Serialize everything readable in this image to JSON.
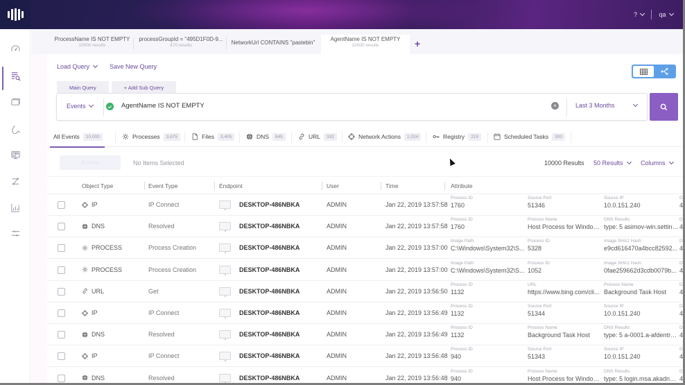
{
  "topbar": {
    "help_label": "?",
    "user_label": "qa"
  },
  "rail": {
    "items": [
      {
        "icon": "dashboard-gauge-icon",
        "active": false
      },
      {
        "icon": "event-search-icon",
        "active": true
      },
      {
        "icon": "endpoint-monitor-icon",
        "active": false
      },
      {
        "icon": "threat-hunting-icon",
        "active": false
      },
      {
        "icon": "devices-icon",
        "active": false
      },
      {
        "icon": "network-flow-icon",
        "active": false
      },
      {
        "icon": "reports-chart-icon",
        "active": false
      },
      {
        "icon": "settings-sliders-icon",
        "active": false
      }
    ]
  },
  "query_tabs": [
    {
      "title": "ProcessName IS NOT EMPTY",
      "sub": "10000 results",
      "active": false
    },
    {
      "title": "processGroupId = \"495D1F0D-9...",
      "sub": "470 results",
      "active": false
    },
    {
      "title": "NetworkUrl CONTAINS \"pastebin\"",
      "sub": "",
      "active": false
    },
    {
      "title": "AgentName IS NOT EMPTY",
      "sub": "10000 results",
      "active": true
    }
  ],
  "add_tab_label": "+",
  "toolbar": {
    "load_query": "Load Query",
    "save_new_query": "Save New Query"
  },
  "sub_tabs": {
    "main_query": "Main Query",
    "add_sub_query": "+ Add Sub Query"
  },
  "query": {
    "scope": "Events",
    "text": "AgentName IS NOT EMPTY",
    "time_range": "Last 3 Months",
    "valid_color": "#3bb36b",
    "accent_color": "#8b5ec4"
  },
  "filters": [
    {
      "label": "All Events",
      "count": "10,000",
      "icon": "",
      "active": true
    },
    {
      "label": "Processes",
      "count": "3,875",
      "icon": "gear-icon",
      "active": false
    },
    {
      "label": "Files",
      "count": "3,405",
      "icon": "file-icon",
      "active": false
    },
    {
      "label": "DNS",
      "count": "845",
      "icon": "globe-icon",
      "active": false
    },
    {
      "label": "URL",
      "count": "332",
      "icon": "link-icon",
      "active": false
    },
    {
      "label": "Network Actions",
      "count": "1,024",
      "icon": "network-icon",
      "active": false
    },
    {
      "label": "Registry",
      "count": "219",
      "icon": "key-icon",
      "active": false
    },
    {
      "label": "Scheduled Tasks",
      "count": "300",
      "icon": "calendar-icon",
      "active": false
    }
  ],
  "actions": {
    "action_button": "Actions",
    "selection_status": "No Items Selected",
    "results_total": "10000 Results",
    "per_page": "50 Results",
    "columns": "Columns"
  },
  "table": {
    "columns": [
      "Object Type",
      "Event Type",
      "Endpoint",
      "User",
      "Time",
      "Attribute"
    ],
    "rows": [
      {
        "otype": "IP",
        "icon": "ip-icon",
        "etype": "IP Connect",
        "endpoint": "DESKTOP-486NBKA",
        "user": "ADMIN",
        "time": "Jan 22, 2019 13:57:58",
        "attrs": [
          {
            "l": "Process ID",
            "v": "1760"
          },
          {
            "l": "Source Port",
            "v": "51346"
          },
          {
            "l": "Source IP",
            "v": "10.0.151.240"
          }
        ]
      },
      {
        "otype": "DNS",
        "icon": "globe-icon",
        "etype": "Resolved",
        "endpoint": "DESKTOP-486NBKA",
        "user": "ADMIN",
        "time": "Jan 22, 2019 13:57:58",
        "attrs": [
          {
            "l": "Process ID",
            "v": "1760"
          },
          {
            "l": "Process Name",
            "v": "Host Process for Window..."
          },
          {
            "l": "DNS Results",
            "v": "type: 5 asimov-win.setting..."
          }
        ]
      },
      {
        "otype": "PROCESS",
        "icon": "gear-icon",
        "etype": "Process Creation",
        "endpoint": "DESKTOP-486NBKA",
        "user": "ADMIN",
        "time": "Jan 22, 2019 13:57:00",
        "attrs": [
          {
            "l": "Image Path",
            "v": "C:\\Windows\\System32\\S..."
          },
          {
            "l": "Process ID",
            "v": "5328"
          },
          {
            "l": "Image SHA1 Hash",
            "v": "e9cd616470a4bcc82592..."
          }
        ]
      },
      {
        "otype": "PROCESS",
        "icon": "gear-icon",
        "etype": "Process Creation",
        "endpoint": "DESKTOP-486NBKA",
        "user": "ADMIN",
        "time": "Jan 22, 2019 13:57:00",
        "attrs": [
          {
            "l": "Image Path",
            "v": "C:\\Windows\\System32\\S..."
          },
          {
            "l": "Process ID",
            "v": "1052"
          },
          {
            "l": "Image SHA1 Hash",
            "v": "0fae259662d3cdb0079b..."
          }
        ]
      },
      {
        "otype": "URL",
        "icon": "link-icon",
        "etype": "Get",
        "endpoint": "DESKTOP-486NBKA",
        "user": "ADMIN",
        "time": "Jan 22, 2019 13:56:50",
        "attrs": [
          {
            "l": "Process ID",
            "v": "1132"
          },
          {
            "l": "URL",
            "v": "https://www.bing.com/cli..."
          },
          {
            "l": "Process Name",
            "v": "Background Task Host"
          }
        ]
      },
      {
        "otype": "IP",
        "icon": "ip-icon",
        "etype": "IP Connect",
        "endpoint": "DESKTOP-486NBKA",
        "user": "ADMIN",
        "time": "Jan 22, 2019 13:56:49",
        "attrs": [
          {
            "l": "Process ID",
            "v": "1132"
          },
          {
            "l": "Source Port",
            "v": "51344"
          },
          {
            "l": "Source IP",
            "v": "10.0.151.240"
          }
        ]
      },
      {
        "otype": "DNS",
        "icon": "globe-icon",
        "etype": "Resolved",
        "endpoint": "DESKTOP-486NBKA",
        "user": "ADMIN",
        "time": "Jan 22, 2019 13:56:49",
        "attrs": [
          {
            "l": "Process ID",
            "v": "1132"
          },
          {
            "l": "Process Name",
            "v": "Background Task Host"
          },
          {
            "l": "DNS Results",
            "v": "type: 5 a-0001.a-afdentry...."
          }
        ]
      },
      {
        "otype": "IP",
        "icon": "ip-icon",
        "etype": "IP Connect",
        "endpoint": "DESKTOP-486NBKA",
        "user": "ADMIN",
        "time": "Jan 22, 2019 13:56:48",
        "attrs": [
          {
            "l": "Process ID",
            "v": "940"
          },
          {
            "l": "Source Port",
            "v": "51343"
          },
          {
            "l": "Source IP",
            "v": "10.0.151.240"
          }
        ]
      },
      {
        "otype": "DNS",
        "icon": "globe-icon",
        "etype": "Resolved",
        "endpoint": "DESKTOP-486NBKA",
        "user": "ADMIN",
        "time": "Jan 22, 2019 13:56:48",
        "attrs": [
          {
            "l": "Process ID",
            "v": "940"
          },
          {
            "l": "Process Name",
            "v": "Host Process for Window..."
          },
          {
            "l": "DNS Results",
            "v": "type: 5 login.msa.akadns6..."
          }
        ]
      }
    ]
  }
}
